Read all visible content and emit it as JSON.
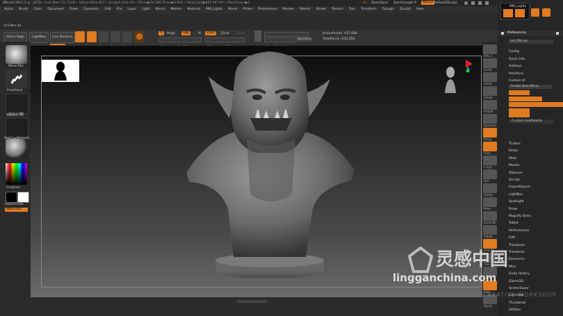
{
  "titlebar": {
    "app_title": "ZBrush 2021.1 ◎ _3173",
    "stats": "• Free Mem 15.71GB • Active Mem 667 • Scratch Disk 49 • ZTime▶14.386 Timer▶0.063 • PolyCount▶865.667 KP • MeshCount▶1",
    "quicksave": "QuickSave",
    "seethrough": "See-through 0",
    "menus_label": "Menus",
    "defaultzscript": "DefaultZScript"
  },
  "menubar": [
    "Alpha",
    "Brush",
    "Color",
    "Document",
    "Draw",
    "Dynamics",
    "Edit",
    "File",
    "Layer",
    "Light",
    "Macro",
    "Marker",
    "Material",
    "MM_Lights",
    "Movie",
    "Picker",
    "Preferences",
    "Render",
    "Stencil",
    "Stroke",
    "Texture",
    "Tool",
    "Transform",
    "Zplugin",
    "Zscript",
    "Help"
  ],
  "ui_filter": "UI Filter 41",
  "toolbar": {
    "home_page": "Home Page",
    "lightbox": "LightBox",
    "live_boolean": "Live Boolean",
    "edit": "Edit",
    "draw": "Draw",
    "move": "Move",
    "scale": "Scale",
    "rotate": "Rotate",
    "a_label": "A",
    "mrgb": "Mrgb",
    "rgb": "Rgb",
    "m": "M",
    "zadd": "Zadd",
    "zsub": "Zsub",
    "zcut": "Zcut",
    "rgb_intensity": "Rgb Intensity 100",
    "z_intensity": "Z Intensity 25",
    "focal_shift": "Focal Shift 0",
    "draw_size": "Draw Size 64",
    "dynamic": "Dynamic",
    "active_points": "ActivePoints: 437,686",
    "total_points": "TotalPoints: 432,056"
  },
  "leftshelf": {
    "brush": "Move Pbs",
    "stroke": "FreeHand",
    "alpha": "Alpha Off",
    "texture": "Texture Off",
    "material": "MatCapWhite01",
    "gradient": "Gradient",
    "switchcolor": "SwitchColor",
    "alternate": "Alternate"
  },
  "rightshelf": [
    "SPix 3",
    "Scroll",
    "Zoom",
    "Actual",
    "AAHalf",
    "Dynamic",
    "Persp",
    "Floor",
    "L.Sym",
    "Xyz",
    "Frame",
    "Move",
    "Zoom3D",
    "Rotate",
    "Line Fill",
    "Transp",
    "Ghost",
    "Solo",
    "Xpose"
  ],
  "panel": {
    "header": "MM_Lights",
    "preferences": "Preferences",
    "init_zbrush": "Init ZBrush",
    "items_top": [
      "Config",
      "Quick Info",
      "Hotkeys",
      "Interface",
      "Custom UI"
    ],
    "create_new_menu": "Create New Menu",
    "custom_subpalette": "Custom SubPalette",
    "items_bottom": [
      "TColors",
      "Picker",
      "Mem",
      "Marker",
      "ZSphere",
      "Zscript",
      "ImportExport",
      "LightBox",
      "SpotLight",
      "Draw",
      "Magnify Glass",
      "Tablet",
      "Performance",
      "Edit",
      "Transpose",
      "Transform",
      "Dynamics",
      "Misc",
      "Undo History",
      "Gizmo3D",
      "ScreenSaver",
      "CamView",
      "Thumbnail",
      "Utilities"
    ]
  },
  "watermark": {
    "cn": "灵感中国",
    "url": "lingganchina.com",
    "sub": "CREATIVE WORKSHOP"
  }
}
